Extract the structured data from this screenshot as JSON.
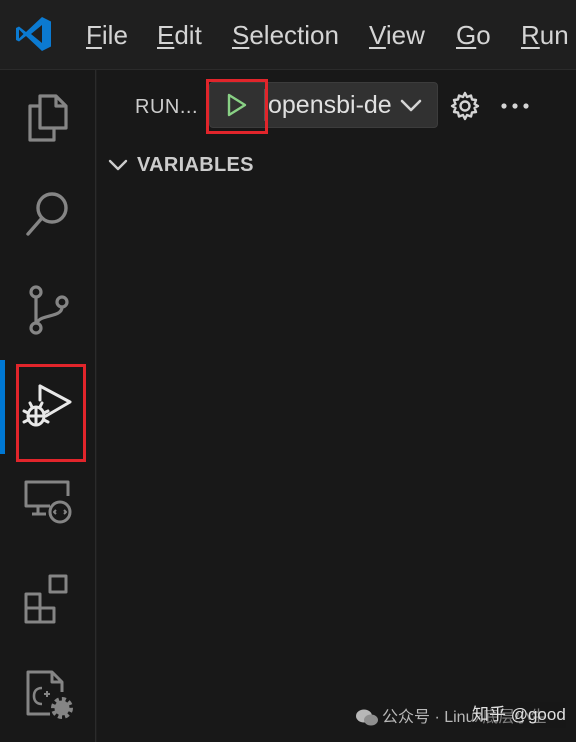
{
  "menubar": {
    "items": [
      {
        "label": "File",
        "mnemonic": "F",
        "rest": "ile"
      },
      {
        "label": "Edit",
        "mnemonic": "E",
        "rest": "dit"
      },
      {
        "label": "Selection",
        "mnemonic": "S",
        "rest": "election"
      },
      {
        "label": "View",
        "mnemonic": "V",
        "rest": "iew"
      },
      {
        "label": "Go",
        "mnemonic": "G",
        "rest": "o"
      },
      {
        "label": "Run",
        "mnemonic": "R",
        "rest": "un"
      }
    ]
  },
  "activitybar": {
    "items": [
      {
        "name": "explorer",
        "icon": "files-icon"
      },
      {
        "name": "search",
        "icon": "search-icon"
      },
      {
        "name": "source-control",
        "icon": "source-control-icon"
      },
      {
        "name": "run-and-debug",
        "icon": "run-debug-icon",
        "active": true
      },
      {
        "name": "remote-explorer",
        "icon": "remote-explorer-icon"
      },
      {
        "name": "extensions",
        "icon": "extensions-icon"
      },
      {
        "name": "cpp-settings",
        "icon": "cpp-gear-icon"
      }
    ]
  },
  "sidebar": {
    "title": "RUN...",
    "start_button_icon": "play-icon",
    "config_name": "opensbi-de",
    "section": "VARIABLES"
  },
  "watermark": {
    "text": "公众号 · Linux底层小生",
    "overlay": "知乎 @good"
  },
  "colors": {
    "accent": "#0078d4",
    "highlight_box": "#e1252b",
    "play_green": "#89d185",
    "background": "#181818"
  }
}
